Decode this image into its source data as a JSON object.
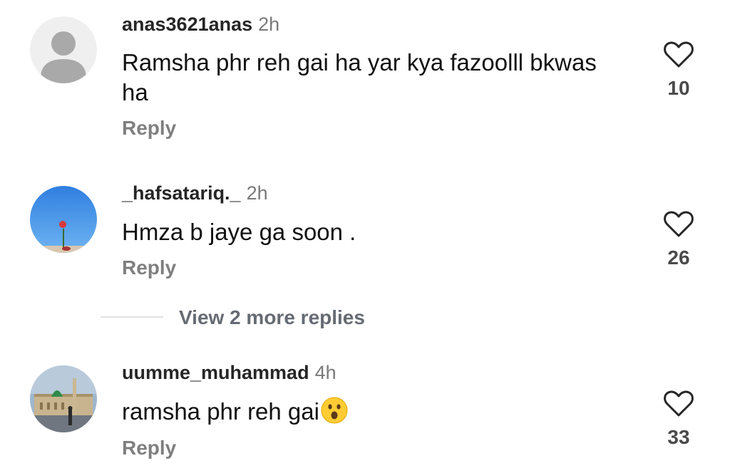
{
  "comments": [
    {
      "username": "anas3621anas",
      "time": "2h",
      "text": "Ramsha phr reh gai ha yar kya fazoolll bkwas ha",
      "reply_label": "Reply",
      "likes": "10",
      "avatar": "default-user-avatar"
    },
    {
      "username": "_hafsatariq._",
      "time": "2h",
      "text": "Hmza b jaye ga soon .",
      "reply_label": "Reply",
      "likes": "26",
      "avatar": "photo-rose-sky-avatar"
    },
    {
      "username": "uumme_muhammad",
      "time": "4h",
      "text": "ramsha phr reh gai",
      "emoji": "astonished-face",
      "reply_label": "Reply",
      "likes": "33",
      "avatar": "photo-mosque-avatar"
    }
  ],
  "view_more_replies": "View 2 more replies",
  "colors": {
    "username": "#262626",
    "secondary": "#7f7f7f",
    "heart_stroke": "#262626"
  }
}
